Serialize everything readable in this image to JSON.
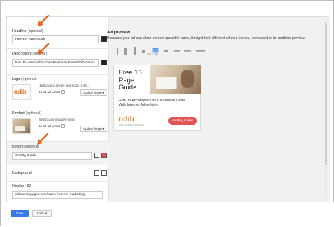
{
  "fields": {
    "headline": {
      "label": "Headline",
      "optional": "(optional)",
      "value": "Free 16 Page Guide",
      "color": "#222222"
    },
    "description": {
      "label": "Description",
      "optional": "(optional)",
      "value": "How To Accomplish Your Business Goals With Intern",
      "color": "#222222"
    },
    "logo": {
      "label": "Logo",
      "optional": "(optional)",
      "filename": "1u8kgds-current-ndib-logo_043...",
      "sizes": "In all ad sizes",
      "update_label": "Update image ▾"
    },
    "product": {
      "label": "Product",
      "optional": "(optional)",
      "filename": "6e367da5-image2-5.jpg",
      "sizes": "In all ad sizes",
      "update_label": "Update image ▾"
    },
    "button": {
      "label": "Button",
      "optional": "(optional)",
      "value": "Get My Guide",
      "color_bg": "#ffffff",
      "color_accent": "#e05454"
    },
    "background": {
      "label": "Background"
    },
    "display_url": {
      "label": "Display URL",
      "value": "unbouncepages.com/nates-internet-marketing/"
    }
  },
  "preview": {
    "title": "Ad preview",
    "subtitle": "Because your ad can show in more possible sizes, it might look different when it serves, compared to its realtime preview.",
    "selected_size": "300 × 250",
    "ad": {
      "headline": "Free 16 Page Guide",
      "description": "How To Accomplish Your Business Goals With Internet Advertising",
      "logo_text": "ndib",
      "logo_sub": "NATE'S INTERNET MARKETING",
      "cta": "Get My Guide"
    }
  },
  "footer": {
    "done_label": "Done",
    "cancel_label": "Cancel"
  },
  "colors": {
    "accent_blue": "#3b78e7",
    "arrow_orange": "#e8661c",
    "cta_red": "#e05454",
    "logo_orange": "#e07a22"
  }
}
